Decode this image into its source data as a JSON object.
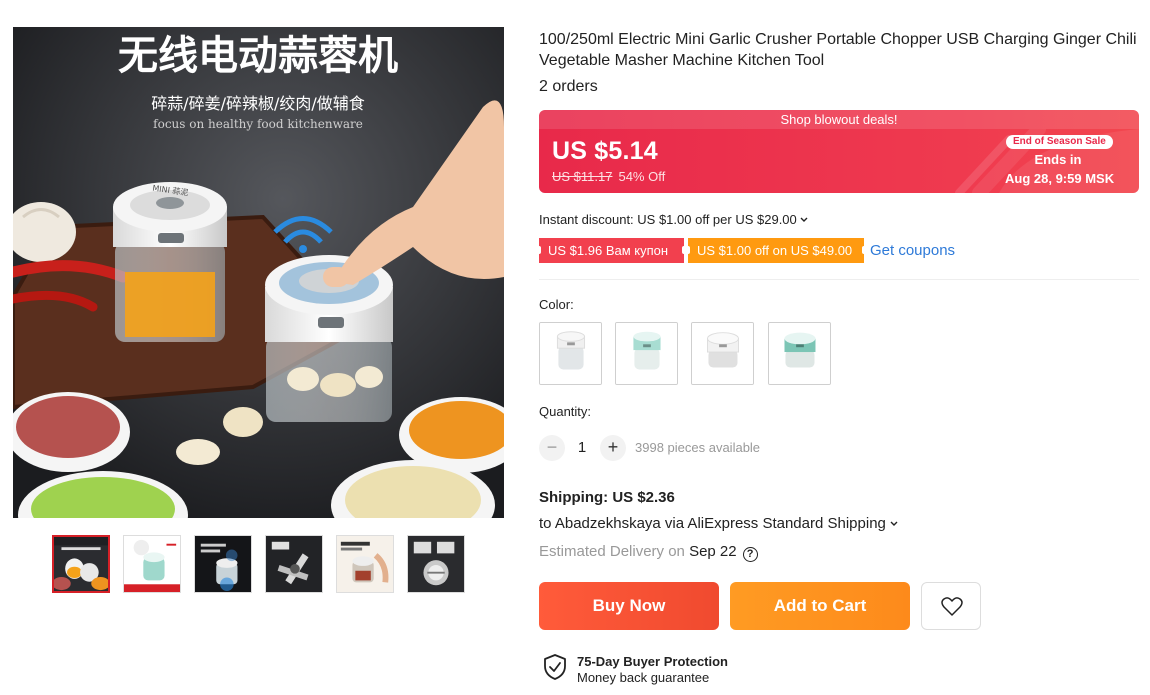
{
  "gallery": {
    "main_image_heading": "无线电动蒜蓉机",
    "main_image_subheading": "碎蒜/碎姜/碎辣椒/绞肉/做辅食",
    "main_image_tagline": "focus on healthy food kitchenware",
    "device_label": "MINI 蒜泥",
    "thumbnails": [
      {
        "active": true
      },
      {
        "active": false
      },
      {
        "active": false
      },
      {
        "active": false
      },
      {
        "active": false
      },
      {
        "active": false
      }
    ]
  },
  "product": {
    "title": "100/250ml Electric Mini Garlic Crusher Portable Chopper USB Charging Ginger Chili Vegetable Masher Machine Kitchen Tool",
    "orders": "2 orders"
  },
  "deal": {
    "banner_text": "Shop blowout deals!",
    "price": "US $5.14",
    "old_price": "US $11.17",
    "discount": "54% Off",
    "season_badge": "End of Season Sale",
    "ends_in_label": "Ends in",
    "ends_date": "Aug 28, 9:59 MSK",
    "colors": {
      "banner": "#e8294a",
      "badge_text": "#e8294a"
    }
  },
  "discounts": {
    "instant_discount": "Instant discount: US $1.00 off per US $29.00",
    "coupons": [
      {
        "text": "US $1.96 Вам купон",
        "color": "#f2404e"
      },
      {
        "text": "US $1.00 off on US $49.00",
        "color": "#ff9a10"
      }
    ],
    "get_coupons": "Get coupons"
  },
  "color": {
    "label": "Color:",
    "options": [
      {
        "icon": "chopper-white-clear"
      },
      {
        "icon": "chopper-mint"
      },
      {
        "icon": "chopper-white"
      },
      {
        "icon": "chopper-teal"
      }
    ]
  },
  "quantity": {
    "label": "Quantity:",
    "minus": "−",
    "value": "1",
    "plus": "+",
    "available": "3998 pieces available"
  },
  "shipping": {
    "cost": "Shipping: US $2.36",
    "destination": "to Abadzekhskaya via AliExpress Standard Shipping",
    "estimated_label": "Estimated Delivery on",
    "estimated_date": "Sep 22",
    "help_icon": "?"
  },
  "actions": {
    "buy_now": "Buy Now",
    "add_to_cart": "Add to Cart",
    "colors": {
      "buy": "#f04a2f",
      "cart": "#fd8a1b"
    }
  },
  "protection": {
    "title": "75-Day Buyer Protection",
    "subtitle": "Money back guarantee"
  }
}
